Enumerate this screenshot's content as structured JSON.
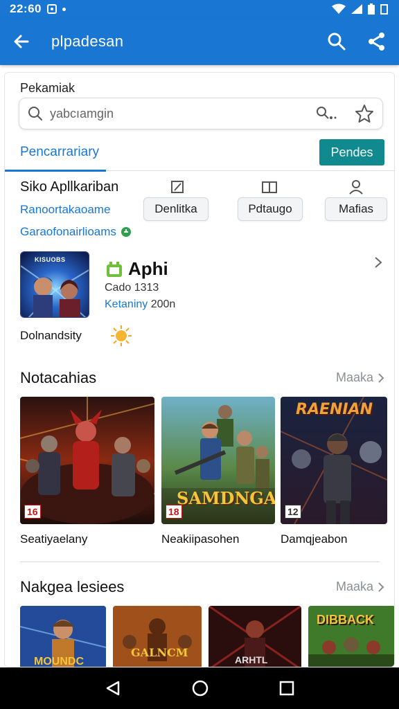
{
  "status_bar": {
    "time": "22:60"
  },
  "app_bar": {
    "title": "plpadesan"
  },
  "top_section": {
    "label": "Pekamiak"
  },
  "search": {
    "placeholder": "yabcıamgin"
  },
  "tabs": {
    "active": "Pencarrariary",
    "action_button": "Pendes"
  },
  "apps_header": {
    "title": "Siko Apllkariban",
    "link_1": "Ranoortakaoame",
    "link_2": "Garaofonairlioams",
    "chips": [
      "Denlitka",
      "Pdtaugo",
      "Mafias"
    ]
  },
  "featured_app": {
    "thumb_text": "KISUOBS",
    "title": "Aphi",
    "meta_1": "Cado 1313",
    "meta_category": "Ketaniny",
    "meta_year": "200n",
    "subtitle": "Dolnandsity"
  },
  "row_1": {
    "title": "Notacahias",
    "more_label": "Maaka",
    "items": [
      {
        "label": "Seatiyaelany",
        "badge": "16",
        "art_text": ""
      },
      {
        "label": "Neakiipasohen",
        "badge": "18",
        "art_text": "SAMDNGAK"
      },
      {
        "label": "Damqjeabon",
        "badge": "12",
        "art_text": "RAENIAN"
      }
    ]
  },
  "row_2": {
    "title": "Nakgea lesiees",
    "more_label": "Maaka",
    "items": [
      {
        "art_text": "MOUNDC"
      },
      {
        "art_text": "GALNCM"
      },
      {
        "art_text": "ARHTL"
      },
      {
        "art_text": "DIBBACK"
      }
    ]
  },
  "colors": {
    "primary": "#1976d2",
    "accent_button": "#118a8f",
    "more_gray": "#8a8f96"
  }
}
